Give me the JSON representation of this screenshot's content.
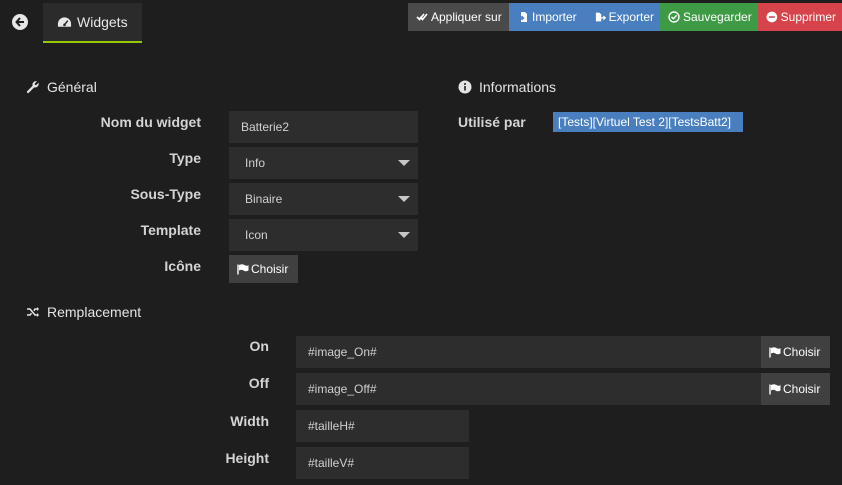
{
  "header": {
    "tab_label": "Widgets",
    "actions": {
      "apply": "Appliquer sur",
      "import": "Importer",
      "export": "Exporter",
      "save": "Sauvegarder",
      "delete": "Supprimer"
    }
  },
  "general": {
    "title": "Général",
    "name_label": "Nom du widget",
    "name_value": "Batterie2",
    "type_label": "Type",
    "type_value": "Info",
    "subtype_label": "Sous-Type",
    "subtype_value": "Binaire",
    "template_label": "Template",
    "template_value": "Icon",
    "icon_label": "Icône",
    "choose_label": "Choisir"
  },
  "informations": {
    "title": "Informations",
    "used_by_label": "Utilisé par",
    "used_by_value": "[Tests][Virtuel Test 2][TestsBatt2]"
  },
  "replacement": {
    "title": "Remplacement",
    "on_label": "On",
    "on_value": "#image_On#",
    "off_label": "Off",
    "off_value": "#image_Off#",
    "width_label": "Width",
    "width_value": "#tailleH#",
    "height_label": "Height",
    "height_value": "#tailleV#",
    "choose_label": "Choisir"
  },
  "colors": {
    "background": "#1e1e1e",
    "field": "#2d2d2d",
    "tab_accent": "#94ca02",
    "blue": "#4a7fbf",
    "green": "#3f9a46",
    "red": "#d7434a",
    "gray_button": "#4a4a4a"
  },
  "icons": [
    "back-circle-icon",
    "dashboard-icon",
    "check-double-icon",
    "file-import-icon",
    "file-export-icon",
    "check-circle-icon",
    "minus-circle-icon",
    "wrench-icon",
    "info-circle-icon",
    "random-icon",
    "flag-icon"
  ]
}
